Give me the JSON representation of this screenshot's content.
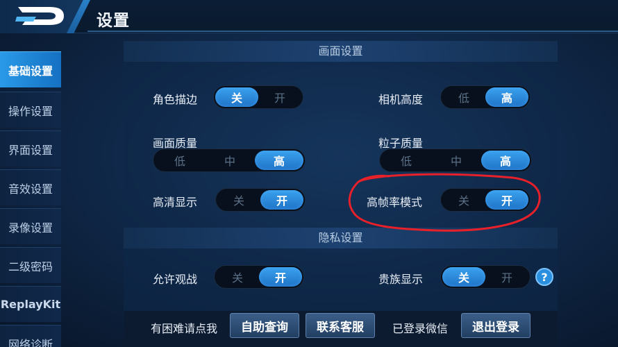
{
  "header": {
    "title": "设置"
  },
  "sidebar": {
    "items": [
      {
        "label": "基础设置",
        "active": true
      },
      {
        "label": "操作设置",
        "active": false
      },
      {
        "label": "界面设置",
        "active": false
      },
      {
        "label": "音效设置",
        "active": false
      },
      {
        "label": "录像设置",
        "active": false
      },
      {
        "label": "二级密码",
        "active": false
      },
      {
        "label": "ReplayKit",
        "active": false
      },
      {
        "label": "网络诊断",
        "active": false
      }
    ]
  },
  "sections": {
    "display": "画面设置",
    "privacy": "隐私设置"
  },
  "settings": {
    "role_outline": {
      "label": "角色描边",
      "options": [
        "关",
        "开"
      ],
      "selected": "关"
    },
    "camera_height": {
      "label": "相机高度",
      "options": [
        "低",
        "高"
      ],
      "selected": "高"
    },
    "image_quality": {
      "label": "画面质量",
      "options": [
        "低",
        "中",
        "高"
      ],
      "selected": "高"
    },
    "particle_quality": {
      "label": "粒子质量",
      "options": [
        "低",
        "中",
        "高"
      ],
      "selected": "高"
    },
    "hd_display": {
      "label": "高清显示",
      "options": [
        "关",
        "开"
      ],
      "selected": "开"
    },
    "high_fps": {
      "label": "高帧率模式",
      "options": [
        "关",
        "开"
      ],
      "selected": "开"
    },
    "allow_spectate": {
      "label": "允许观战",
      "options": [
        "关",
        "开"
      ],
      "selected": "开"
    },
    "noble_display": {
      "label": "贵族显示",
      "options": [
        "关",
        "开"
      ],
      "selected": "关"
    }
  },
  "help_icon": "?",
  "bottom": {
    "hint": "有困难请点我",
    "self_help": "自助查询",
    "contact": "联系客服",
    "wechat_status": "已登录微信",
    "logout": "退出登录"
  },
  "colors": {
    "accent": "#2a9ae8",
    "annotation": "#e8202a"
  }
}
